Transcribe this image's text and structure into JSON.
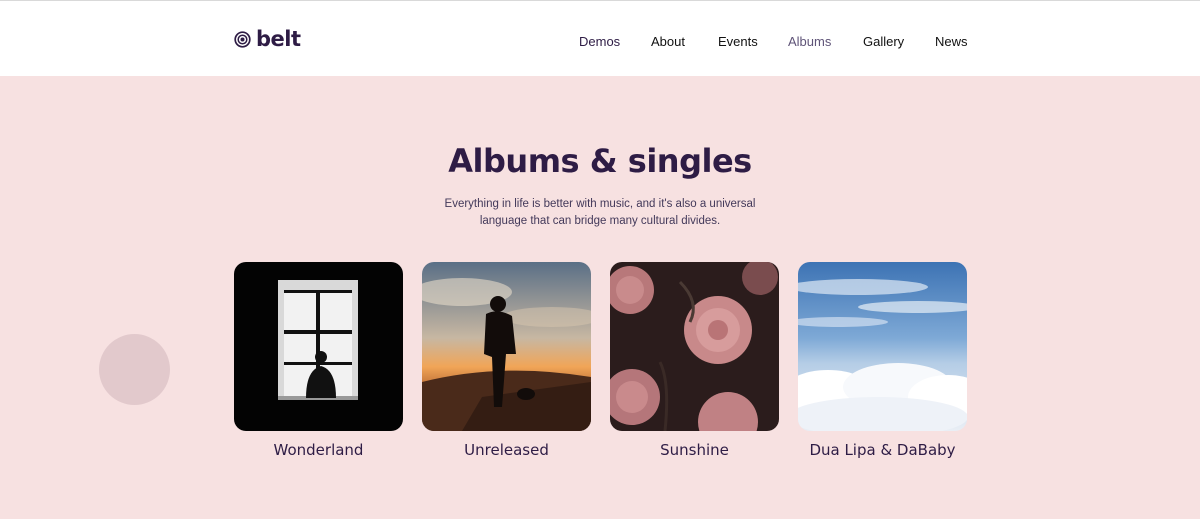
{
  "header": {
    "logo_text": "belt",
    "nav": [
      {
        "label": "Demos"
      },
      {
        "label": "About"
      },
      {
        "label": "Events"
      },
      {
        "label": "Albums"
      },
      {
        "label": "Gallery"
      },
      {
        "label": "News"
      }
    ],
    "active_nav": "Albums"
  },
  "hero": {
    "title": "Albums & singles",
    "subtitle": "Everything in life is better with music, and it's also a universal language that can bridge many cultural divides."
  },
  "albums": [
    {
      "title": "Wonderland",
      "image": "window-silhouette"
    },
    {
      "title": "Unreleased",
      "image": "desert-sunset"
    },
    {
      "title": "Sunshine",
      "image": "pink-roses"
    },
    {
      "title": "Dua Lipa & DaBaby",
      "image": "sky-clouds"
    }
  ],
  "colors": {
    "brand": "#2e1c45",
    "background": "#f7e1e1",
    "header_bg": "#ffffff",
    "active_nav": "#5f5478"
  }
}
